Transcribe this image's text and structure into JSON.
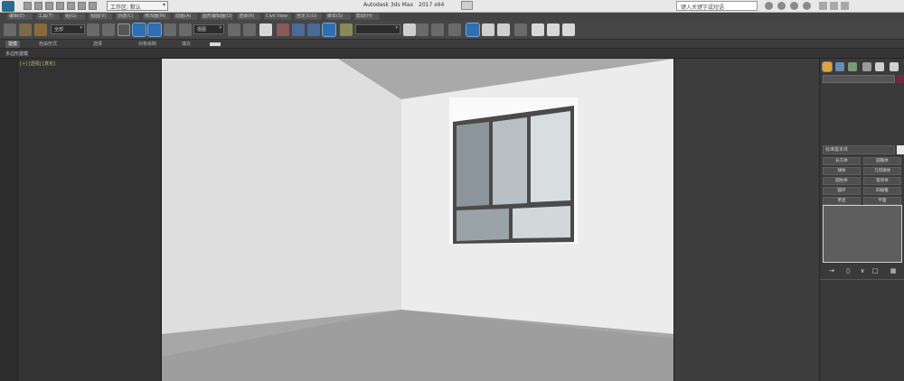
{
  "titlebar": {
    "workspace": "工作区: 默认",
    "app_title": "Autodesk 3ds Max",
    "app_version": "2017 x64",
    "search_placeholder": "键入关键字或短语"
  },
  "menu": [
    "编辑(E)",
    "工具(T)",
    "组(G)",
    "视图(V)",
    "创建(C)",
    "修改器(M)",
    "动画(A)",
    "图形编辑器(D)",
    "渲染(R)",
    "Civil View",
    "自定义(U)",
    "脚本(S)",
    "帮助(H)"
  ],
  "toolbar": {
    "selection_filter": "全部",
    "coordinate_system": "视图"
  },
  "ribbon": {
    "tabs": [
      "建模",
      "自由形式",
      "选择",
      "对象绘制",
      "填充"
    ]
  },
  "subribbon": {
    "label": "多边形建模"
  },
  "explorer": {
    "note": "[+] [透视] [真实]"
  },
  "command_panel": {
    "dropdown": "标准基本体",
    "buttons": [
      "长方体",
      "圆锥体",
      "球体",
      "几何球体",
      "圆柱体",
      "管状体",
      "圆环",
      "四棱锥",
      "茶壶",
      "平面"
    ]
  },
  "colors": {
    "accent": "#6fa8dc",
    "object_color": "#7a2540"
  }
}
